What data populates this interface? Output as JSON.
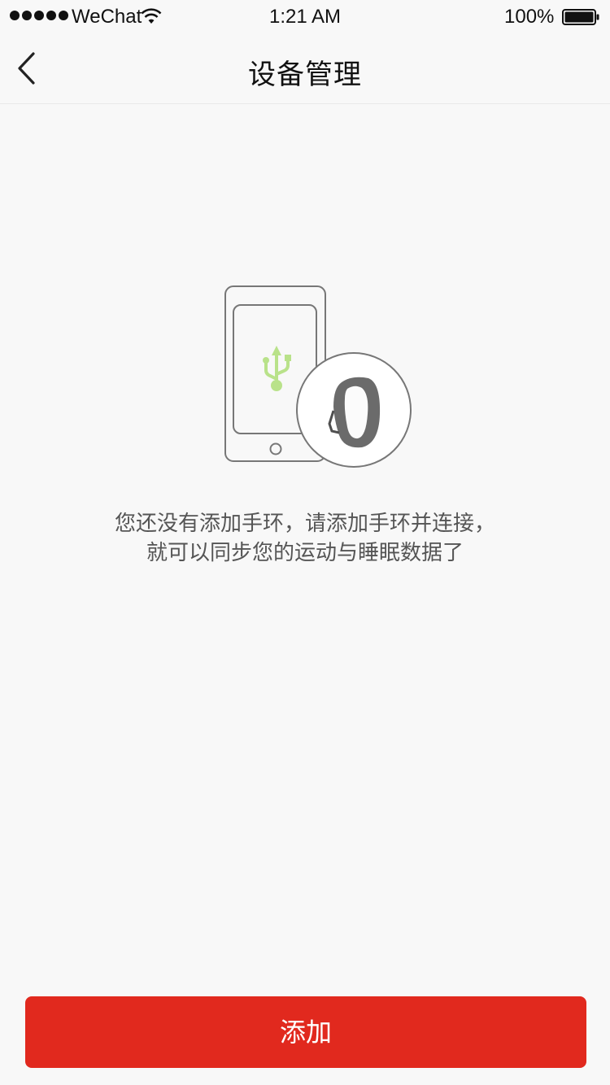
{
  "status_bar": {
    "carrier": "WeChat",
    "time": "1:21 AM",
    "battery_percent": "100%",
    "icons": [
      "signal-dots-icon",
      "wifi-icon",
      "battery-icon"
    ]
  },
  "nav": {
    "title": "设备管理",
    "back_icon": "chevron-left-icon"
  },
  "empty_state": {
    "illustration_icons": [
      "phone-icon",
      "usb-icon",
      "wristband-icon"
    ],
    "line1": "您还没有添加手环，请添加手环并连接，",
    "line2": "就可以同步您的运动与睡眠数据了"
  },
  "actions": {
    "add_label": "添加"
  },
  "colors": {
    "accent": "#e1291e",
    "usb_green": "#b9e28a",
    "background": "#f8f8f8"
  }
}
